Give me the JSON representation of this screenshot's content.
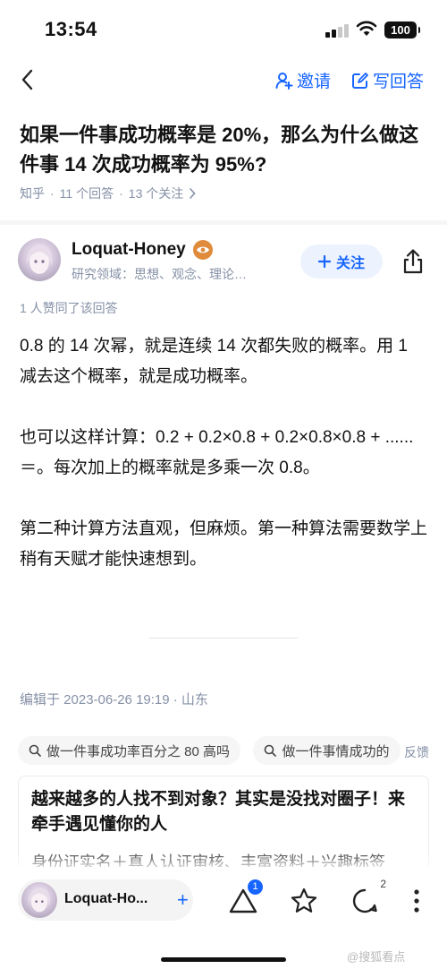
{
  "status_bar": {
    "time": "13:54",
    "battery": "100"
  },
  "nav": {
    "invite_label": "邀请",
    "write_label": "写回答"
  },
  "question": {
    "title": "如果一件事成功概率是 20%，那么为什么做这件事 14 次成功概率为 95%?",
    "source": "知乎",
    "answers_count": "11 个回答",
    "followers_count": "13 个关注"
  },
  "author": {
    "name": "Loquat-Honey",
    "description": "研究领域：思想、观念、理论…",
    "follow_label": "关注",
    "badge_icon": "eye-icon"
  },
  "answer": {
    "likers": "1 人赞同了该回答",
    "paragraphs": [
      "0.8 的 14 次幂，就是连续 14 次都失败的概率。用 1 减去这个概率，就是成功概率。",
      "也可以这样计算：0.2 + 0.2×0.8 + 0.2×0.8×0.8 + ......＝。每次加上的概率就是多乘一次 0.8。",
      "第二种计算方法直观，但麻烦。第一种算法需要数学上稍有天赋才能快速想到。"
    ],
    "edit_info": "编辑于 2023-06-26 19:19 · 山东"
  },
  "related_searches": [
    "做一件事成功率百分之 80 高吗",
    "做一件事情成功的"
  ],
  "feedback_label": "反馈",
  "ad": {
    "title": "越来越多的人找不到对象？其实是没找对圈子！来牵手遇见懂你的人",
    "description": "身份证实名＋真人认证审核、丰富资料＋兴趣标签"
  },
  "bottom_bar": {
    "author_name": "Loquat-Ho...",
    "plus_label": "+",
    "like_badge": "1",
    "comment_count": "2"
  },
  "watermark": "@搜狐看点"
}
